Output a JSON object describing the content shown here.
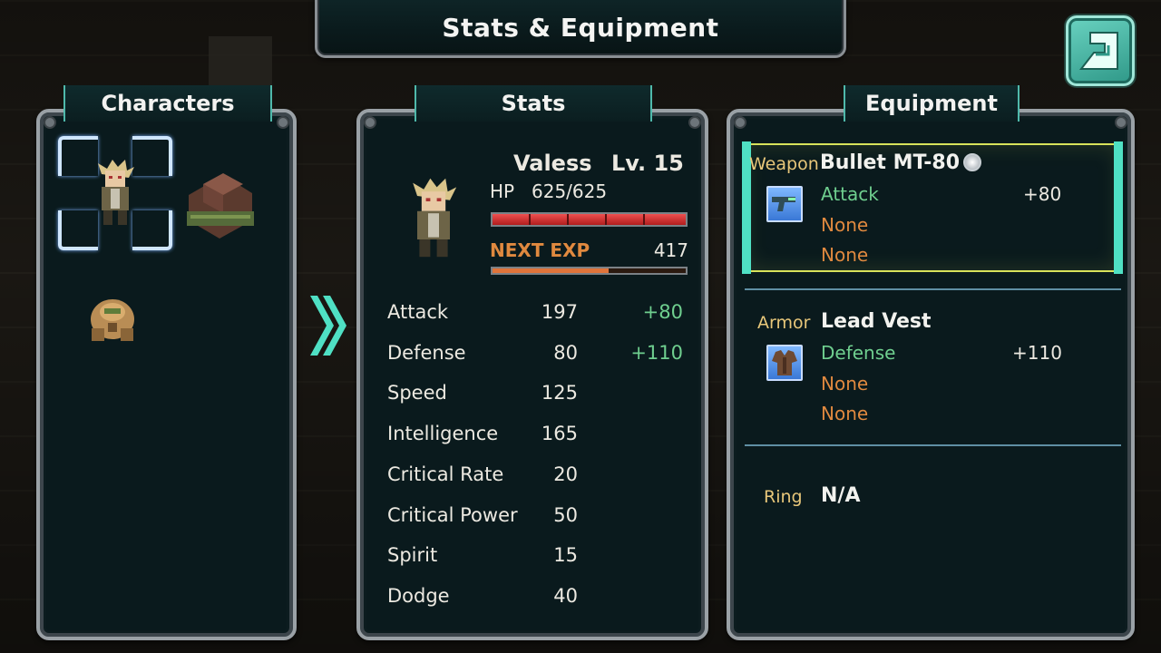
{
  "screen": {
    "title": "Stats & Equipment"
  },
  "tabs": {
    "characters": "Characters",
    "stats": "Stats",
    "equipment": "Equipment"
  },
  "character": {
    "name": "Valess",
    "level": "Lv. 15",
    "hp_label": "HP",
    "hp_value": "625/625",
    "hp_fraction": 1.0,
    "exp_label": "NEXT EXP",
    "exp_value": "417",
    "exp_fraction": 0.6
  },
  "stats": [
    {
      "label": "Attack",
      "value": "197",
      "bonus": "+80"
    },
    {
      "label": "Defense",
      "value": "80",
      "bonus": "+110"
    },
    {
      "label": "Speed",
      "value": "125",
      "bonus": ""
    },
    {
      "label": "Intelligence",
      "value": "165",
      "bonus": ""
    },
    {
      "label": "Critical Rate",
      "value": "20",
      "bonus": ""
    },
    {
      "label": "Critical Power",
      "value": "50",
      "bonus": ""
    },
    {
      "label": "Spirit",
      "value": "15",
      "bonus": ""
    },
    {
      "label": "Dodge",
      "value": "40",
      "bonus": ""
    }
  ],
  "equipment": {
    "weapon": {
      "slot": "Weapon",
      "name": "Bullet MT-80",
      "line1_label": "Attack",
      "line1_value": "+80",
      "line2": "None",
      "line3": "None",
      "icon": "gun-icon"
    },
    "armor": {
      "slot": "Armor",
      "name": "Lead Vest",
      "line1_label": "Defense",
      "line1_value": "+110",
      "line2": "None",
      "line3": "None",
      "icon": "vest-icon"
    },
    "ring": {
      "slot": "Ring",
      "name": "N/A"
    }
  },
  "colors": {
    "accent": "#4fe0c4",
    "bonus_green": "#6fcf8f",
    "none_orange": "#e0893f",
    "slot_gold": "#e8c77a",
    "hp_red": "#d83030",
    "exp_orange": "#e0743a"
  }
}
